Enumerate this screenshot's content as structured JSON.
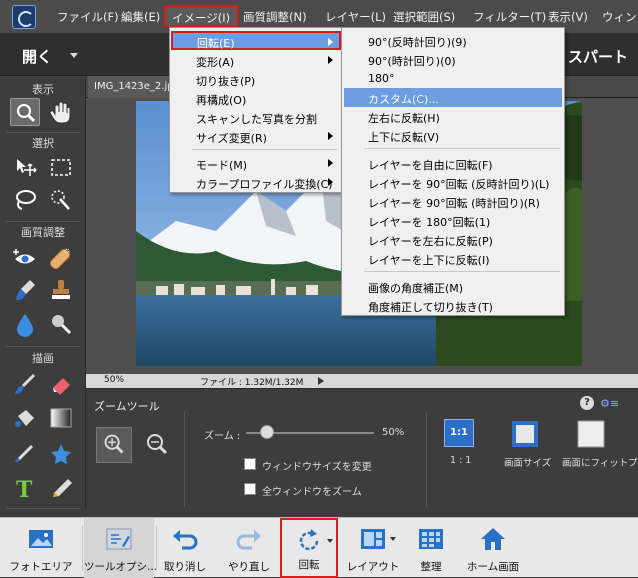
{
  "menubar": {
    "items": [
      "ファイル(F)",
      "編集(E)",
      "イメージ(I)",
      "画質調整(N)",
      "レイヤー(L)",
      "選択範囲(S)",
      "フィルター(T)",
      "表示(V)",
      "ウィンド"
    ]
  },
  "topbar": {
    "open_label": "開く",
    "mode_label": "スパート"
  },
  "tools": {
    "sections": [
      "表示",
      "選択",
      "画質調整",
      "描画",
      "変更"
    ]
  },
  "document": {
    "tab_title": "IMG_1423e_2.jpg",
    "zoom_percent": "50%",
    "file_size": "ファイル : 1.32M/1.32M"
  },
  "options": {
    "title": "ズームツール",
    "zoom_label": "ズーム :",
    "zoom_value": "50%",
    "checkbox_resize": "ウィンドウサイズを変更",
    "checkbox_all": "全ウィンドウをズーム",
    "btn_1to1": "1:1",
    "btn_1to1_label": "1 : 1",
    "btn_screen_label": "画面サイズ",
    "btn_fit_label": "画面にフィット",
    "btn_print_label": "プ"
  },
  "bottombar": {
    "photo_bin": "フォトエリア",
    "tool_options": "ツールオプシ...",
    "undo": "取り消し",
    "redo": "やり直し",
    "rotate": "回転",
    "layout": "レイアウト",
    "organize": "整理",
    "home": "ホーム画面"
  },
  "image_menu": {
    "items": [
      "回転(E)",
      "変形(A)",
      "切り抜き(P)",
      "再構成(O)",
      "スキャンした写真を分割",
      "サイズ変更(R)",
      "モード(M)",
      "カラープロファイル変換(C)"
    ]
  },
  "rotate_menu": {
    "items": [
      "90°(反時計回り)(9)",
      "90°(時計回り)(0)",
      "180°",
      "カスタム(C)...",
      "左右に反転(H)",
      "上下に反転(V)",
      "レイヤーを自由に回転(F)",
      "レイヤーを 90°回転 (反時計回り)(L)",
      "レイヤーを 90°回転 (時計回り)(R)",
      "レイヤーを 180°回転(1)",
      "レイヤーを左右に反転(P)",
      "レイヤーを上下に反転(I)",
      "画像の角度補正(M)",
      "角度補正して切り抜き(T)"
    ]
  },
  "colors": {
    "highlight": "#6d9de0",
    "annotation": "#d81b1b"
  }
}
